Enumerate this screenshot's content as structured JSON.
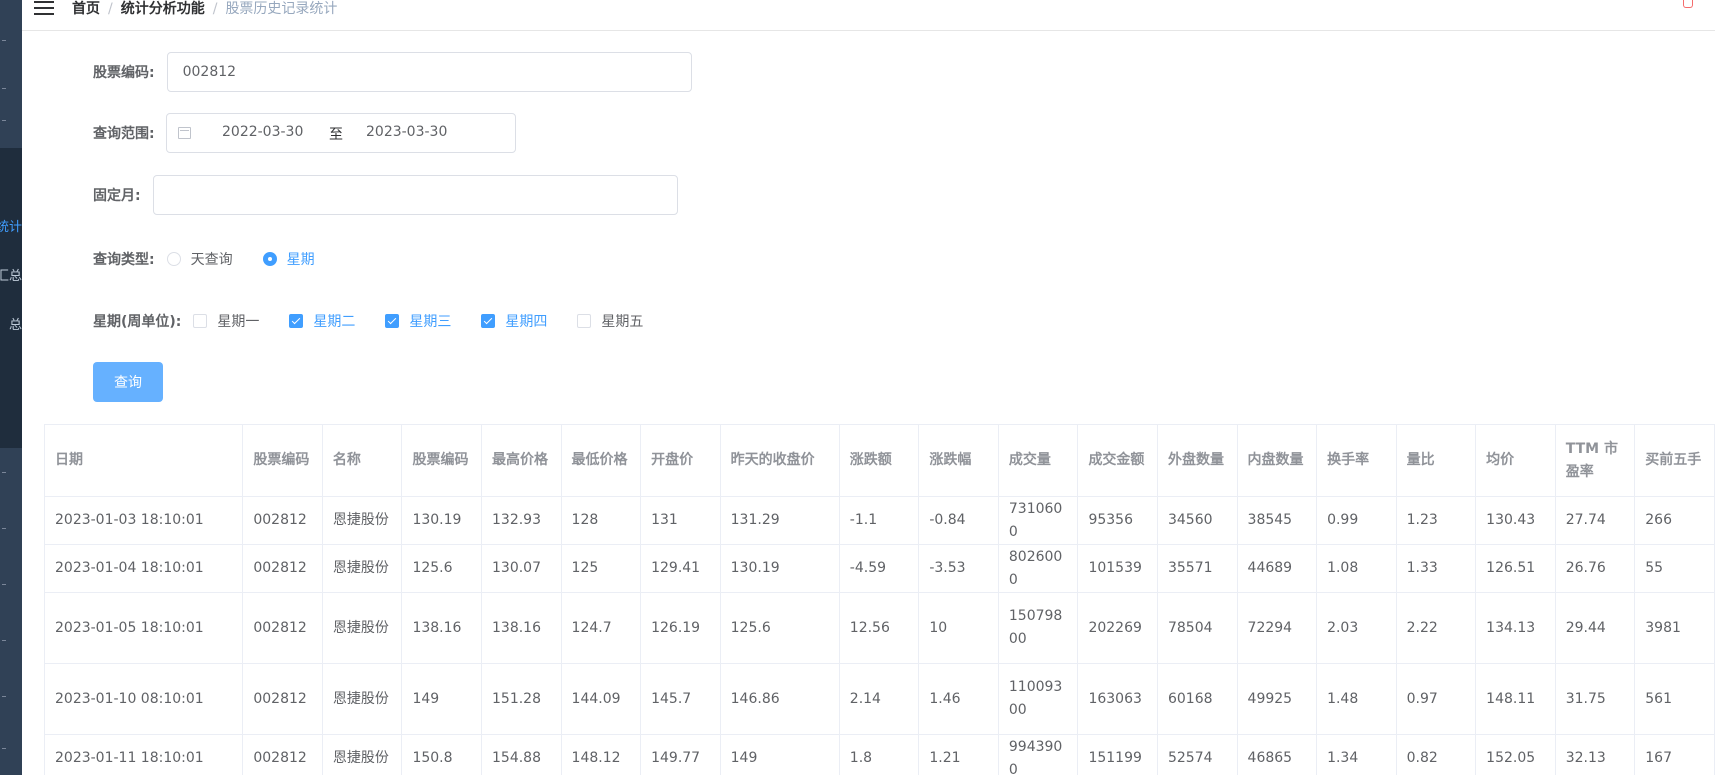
{
  "sidebar": {
    "items": [
      {
        "label": "统计",
        "active": true
      },
      {
        "label": "汇总",
        "active": false
      },
      {
        "label": "总",
        "active": false
      }
    ]
  },
  "breadcrumb": [
    "首页",
    "统计分析功能",
    "股票历史记录统计"
  ],
  "form": {
    "stock_code_label": "股票编码:",
    "stock_code_value": "002812",
    "range_label": "查询范围:",
    "range_start": "2022-03-30",
    "range_separator": "至",
    "range_end": "2023-03-30",
    "fixed_month_label": "固定月:",
    "fixed_month_value": "",
    "query_type_label": "查询类型:",
    "query_types": [
      {
        "label": "天查询",
        "checked": false
      },
      {
        "label": "星期",
        "checked": true
      }
    ],
    "weekday_label": "星期(周单位):",
    "weekdays": [
      {
        "label": "星期一",
        "checked": false
      },
      {
        "label": "星期二",
        "checked": true
      },
      {
        "label": "星期三",
        "checked": true
      },
      {
        "label": "星期四",
        "checked": true
      },
      {
        "label": "星期五",
        "checked": false
      }
    ],
    "query_button": "查询"
  },
  "colors": {
    "accent": "#409eff",
    "button": "#66b1ff",
    "sidebar": "#304156"
  },
  "table": {
    "columns": [
      "日期",
      "股票编码",
      "名称",
      "股票编码",
      "最高价格",
      "最低价格",
      "开盘价",
      "昨天的收盘价",
      "涨跌额",
      "涨跌幅",
      "成交量",
      "成交金额",
      "外盘数量",
      "内盘数量",
      "换手率",
      "量比",
      "均价",
      "TTM 市盈率",
      "买前五手"
    ],
    "rows": [
      [
        "2023-01-03 18:10:01",
        "002812",
        "恩捷股份",
        "130.19",
        "132.93",
        "128",
        "131",
        "131.29",
        "-1.1",
        "-0.84",
        "7310600",
        "95356",
        "34560",
        "38545",
        "0.99",
        "1.23",
        "130.43",
        "27.74",
        "266"
      ],
      [
        "2023-01-04 18:10:01",
        "002812",
        "恩捷股份",
        "125.6",
        "130.07",
        "125",
        "129.41",
        "130.19",
        "-4.59",
        "-3.53",
        "8026000",
        "101539",
        "35571",
        "44689",
        "1.08",
        "1.33",
        "126.51",
        "26.76",
        "55"
      ],
      [
        "2023-01-05 18:10:01",
        "002812",
        "恩捷股份",
        "138.16",
        "138.16",
        "124.7",
        "126.19",
        "125.6",
        "12.56",
        "10",
        "15079800",
        "202269",
        "78504",
        "72294",
        "2.03",
        "2.22",
        "134.13",
        "29.44",
        "3981"
      ],
      [
        "2023-01-10 08:10:01",
        "002812",
        "恩捷股份",
        "149",
        "151.28",
        "144.09",
        "145.7",
        "146.86",
        "2.14",
        "1.46",
        "11009300",
        "163063",
        "60168",
        "49925",
        "1.48",
        "0.97",
        "148.11",
        "31.75",
        "561"
      ],
      [
        "2023-01-11 18:10:01",
        "002812",
        "恩捷股份",
        "150.8",
        "154.88",
        "148.12",
        "149.77",
        "149",
        "1.8",
        "1.21",
        "9943900",
        "151199",
        "52574",
        "46865",
        "1.34",
        "0.82",
        "152.05",
        "32.13",
        "167"
      ]
    ]
  }
}
